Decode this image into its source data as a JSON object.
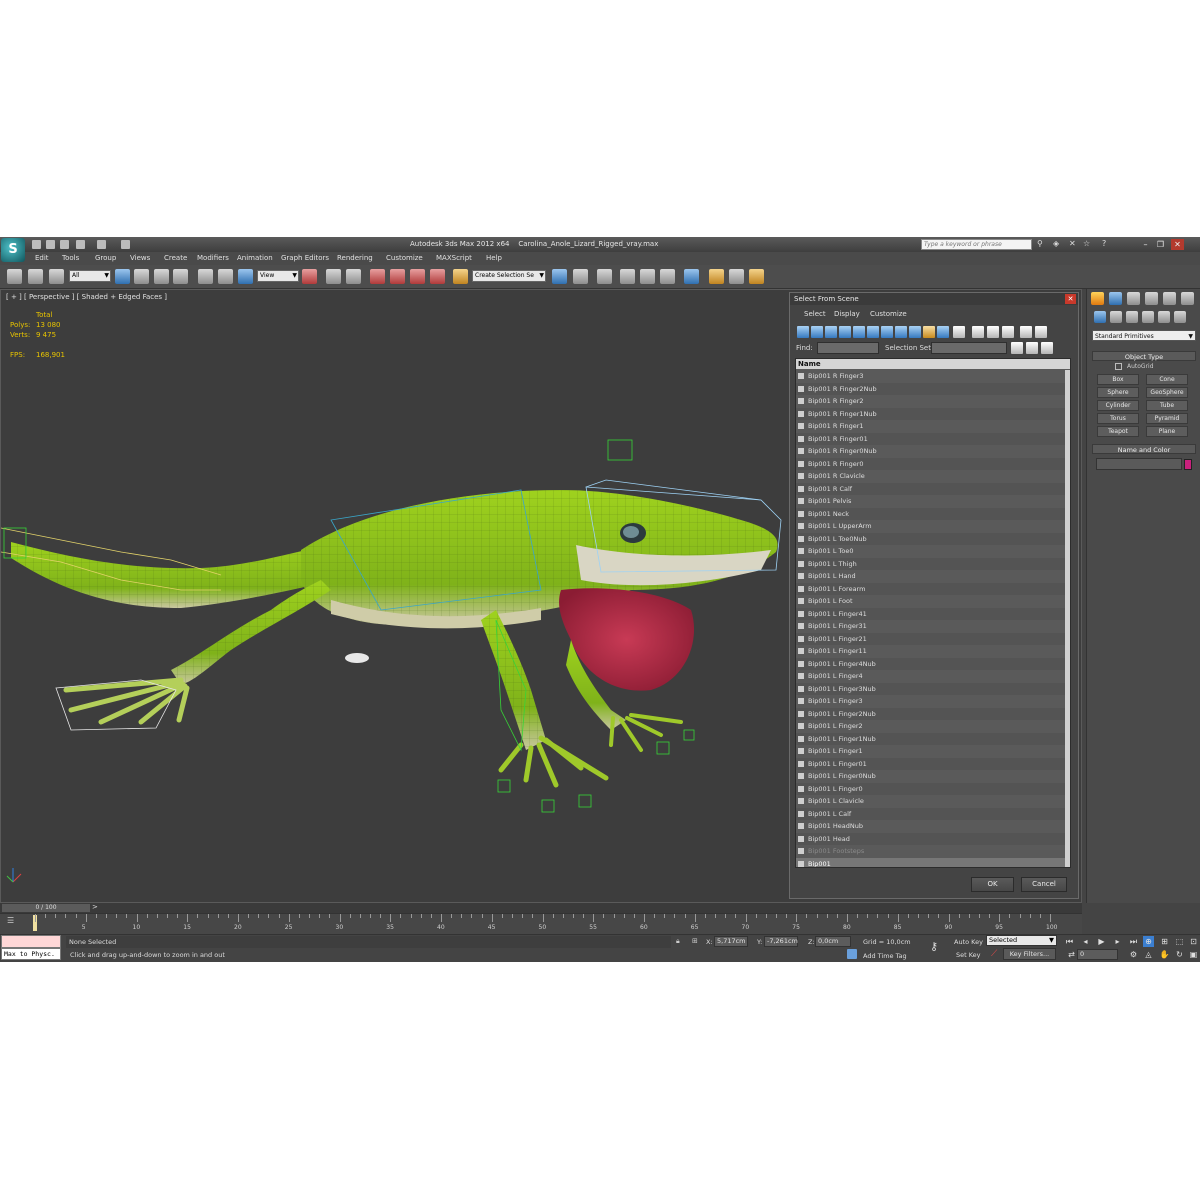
{
  "app": {
    "title": "Autodesk 3ds Max  2012 x64",
    "filename": "Carolina_Anole_Lizard_Rigged_vray.max",
    "search_placeholder": "Type a keyword or phrase"
  },
  "menu": [
    "Edit",
    "Tools",
    "Group",
    "Views",
    "Create",
    "Modifiers",
    "Animation",
    "Graph Editors",
    "Rendering",
    "Customize",
    "MAXScript",
    "Help"
  ],
  "toolbar": {
    "selection_filter": "All",
    "ref_coord": "View",
    "named_selection": "Create Selection Se"
  },
  "viewport": {
    "label": "[ + ] [ Perspective ] [ Shaded + Edged Faces ]",
    "stats_header": "Total",
    "polys_label": "Polys:",
    "polys_value": "13 080",
    "verts_label": "Verts:",
    "verts_value": "9 475",
    "fps_label": "FPS:",
    "fps_value": "168,901"
  },
  "dialog": {
    "title": "Select From Scene",
    "menus": [
      "Select",
      "Display",
      "Customize"
    ],
    "find_label": "Find:",
    "selection_set_label": "Selection Set:",
    "column_header": "Name",
    "items": [
      "Bip001 R Finger3",
      "Bip001 R Finger2Nub",
      "Bip001 R Finger2",
      "Bip001 R Finger1Nub",
      "Bip001 R Finger1",
      "Bip001 R Finger01",
      "Bip001 R Finger0Nub",
      "Bip001 R Finger0",
      "Bip001 R Clavicle",
      "Bip001 R Calf",
      "Bip001 Pelvis",
      "Bip001 Neck",
      "Bip001 L UpperArm",
      "Bip001 L Toe0Nub",
      "Bip001 L Toe0",
      "Bip001 L Thigh",
      "Bip001 L Hand",
      "Bip001 L Forearm",
      "Bip001 L Foot",
      "Bip001 L Finger41",
      "Bip001 L Finger31",
      "Bip001 L Finger21",
      "Bip001 L Finger11",
      "Bip001 L Finger4Nub",
      "Bip001 L Finger4",
      "Bip001 L Finger3Nub",
      "Bip001 L Finger3",
      "Bip001 L Finger2Nub",
      "Bip001 L Finger2",
      "Bip001 L Finger1Nub",
      "Bip001 L Finger1",
      "Bip001 L Finger01",
      "Bip001 L Finger0Nub",
      "Bip001 L Finger0",
      "Bip001 L Clavicle",
      "Bip001 L Calf",
      "Bip001 HeadNub",
      "Bip001 Head",
      "Bip001 Footsteps",
      "Bip001"
    ],
    "ok_label": "OK",
    "cancel_label": "Cancel"
  },
  "command_panel": {
    "category": "Standard Primitives",
    "object_type_title": "Object Type",
    "autogrid_label": "AutoGrid",
    "buttons": [
      "Box",
      "Cone",
      "Sphere",
      "GeoSphere",
      "Cylinder",
      "Tube",
      "Torus",
      "Pyramid",
      "Teapot",
      "Plane"
    ],
    "name_color_title": "Name and Color",
    "object_color": "#c8207c"
  },
  "timeline": {
    "frame_display": "0 / 100",
    "ticks": [
      "0",
      "5",
      "10",
      "15",
      "20",
      "25",
      "30",
      "35",
      "40",
      "45",
      "50",
      "55",
      "60",
      "65",
      "70",
      "75",
      "80",
      "85",
      "90",
      "95",
      "100"
    ]
  },
  "status": {
    "maxscript_output": "Max to Physc.",
    "selection": "None Selected",
    "prompt": "Click and drag up-and-down to zoom in and out",
    "x_label": "X:",
    "x_value": "5,717cm",
    "y_label": "Y:",
    "y_value": "-7,261cm",
    "z_label": "Z:",
    "z_value": "0,0cm",
    "grid": "Grid = 10,0cm",
    "add_time_tag": "Add Time Tag",
    "auto_key": "Auto Key",
    "set_key": "Set Key",
    "key_mode": "Selected",
    "key_filters": "Key Filters...",
    "current_frame": "0"
  }
}
